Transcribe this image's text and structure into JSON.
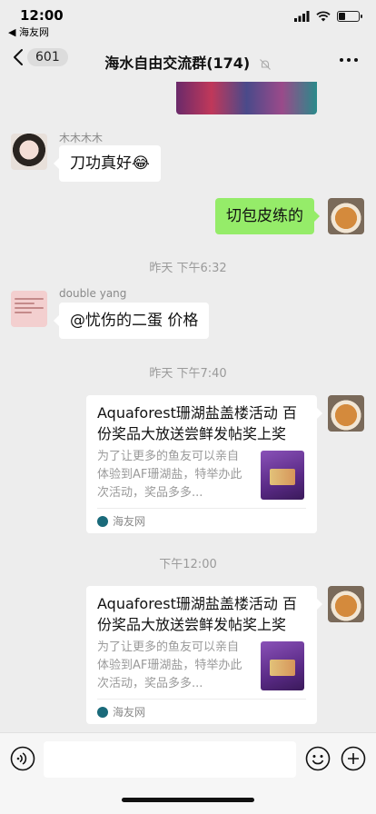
{
  "status_bar": {
    "time": "12:00",
    "back_app": "◀ 海友网"
  },
  "nav": {
    "unread_count": "601",
    "title": "海水自由交流群(174)"
  },
  "messages": [
    {
      "sender": "木木木木",
      "text": "刀功真好😂"
    },
    {
      "text": "切包皮练的"
    },
    {
      "timestamp": "昨天 下午6:32"
    },
    {
      "sender": "double yang",
      "text": "@忧伤的二蛋 价格"
    },
    {
      "timestamp": "昨天 下午7:40"
    },
    {
      "card_title": "Aquaforest珊湖盐盖楼活动 百份奖品大放送尝鲜发帖奖上奖",
      "card_desc": "为了让更多的鱼友可以亲自体验到AF珊湖盐，特举办此次活动，奖品多多...",
      "card_source": "海友网"
    },
    {
      "timestamp": "下午12:00"
    },
    {
      "card_title": "Aquaforest珊湖盐盖楼活动 百份奖品大放送尝鲜发帖奖上奖",
      "card_desc": "为了让更多的鱼友可以亲自体验到AF珊湖盐，特举办此次活动，奖品多多...",
      "card_source": "海友网"
    }
  ],
  "input": {
    "placeholder": ""
  },
  "colors": {
    "chat_bg": "#ededed",
    "bubble_self": "#95ec69",
    "bubble_other": "#ffffff"
  }
}
